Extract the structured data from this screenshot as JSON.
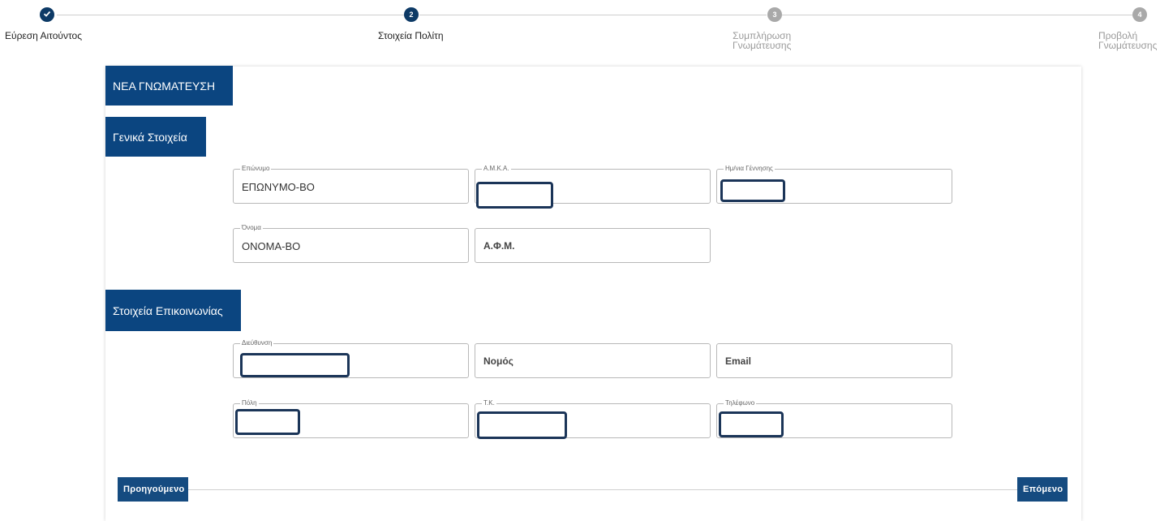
{
  "stepper": {
    "steps": [
      {
        "number": "✓",
        "label": "Εύρεση Αιτούντος",
        "state": "done"
      },
      {
        "number": "2",
        "label": "Στοιχεία Πολίτη",
        "state": "active"
      },
      {
        "number": "3",
        "label": "Συμπλήρωση\nΓνωμάτευσης",
        "state": "pending"
      },
      {
        "number": "4",
        "label": "Προβολή\nΓνωμάτευσης",
        "state": "pending"
      }
    ]
  },
  "form": {
    "title": "ΝΕΑ ΓΝΩΜΑΤΕΥΣΗ",
    "general": {
      "heading": "Γενικά Στοιχεία",
      "surname": {
        "label": "Επώνυμο",
        "value": "ΕΠΩΝΥΜΟ-ΒΟ"
      },
      "amka": {
        "label": "Α.Μ.Κ.Α.",
        "value": ""
      },
      "birthdate": {
        "label": "Ημ/νια Γέννησης",
        "value": ""
      },
      "name": {
        "label": "Όνομα",
        "value": "ΟΝΟΜΑ-ΒΟ"
      },
      "afm": {
        "placeholder": "Α.Φ.Μ."
      }
    },
    "contact": {
      "heading": "Στοιχεία Επικοινωνίας",
      "address": {
        "label": "Διεύθυνση",
        "value": ""
      },
      "prefecture": {
        "placeholder": "Νομός"
      },
      "email": {
        "placeholder": "Email"
      },
      "city": {
        "label": "Πόλη",
        "value": ""
      },
      "postal_code": {
        "label": "Τ.Κ.",
        "value": ""
      },
      "phone": {
        "label": "Τηλέφωνο",
        "value": ""
      }
    }
  },
  "nav": {
    "previous": "Προηγούμενο",
    "next": "Επόμενο"
  },
  "colors": {
    "primary": "#0b4580",
    "redaction": "#1b3558",
    "pending_step": "#a9a9a9"
  }
}
